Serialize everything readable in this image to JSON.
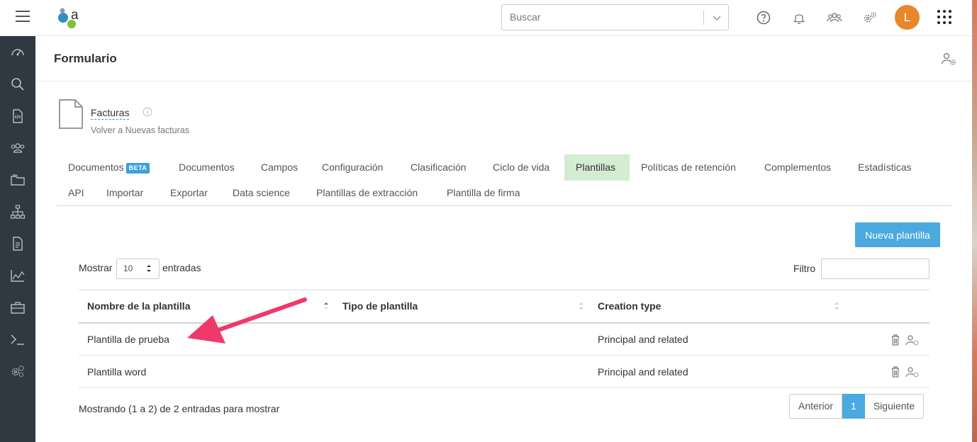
{
  "topbar": {
    "search_placeholder": "Buscar",
    "avatar_initial": "L",
    "icons": [
      "menu-icon",
      "help-icon",
      "bell-icon",
      "users-icon",
      "settings-icon",
      "apps-grid-icon"
    ]
  },
  "sidebar": {
    "icons": [
      "dashboard-icon",
      "search-icon",
      "code-file-icon",
      "group-icon",
      "folder-icon",
      "org-chart-icon",
      "document-icon",
      "chart-icon",
      "toolbox-icon",
      "terminal-icon",
      "gears-icon"
    ]
  },
  "page": {
    "title": "Formulario"
  },
  "form": {
    "name": "Facturas",
    "back_link": "Volver a Nuevas facturas"
  },
  "tabs": {
    "row1": [
      {
        "label": "Documentos",
        "badge": "BETA"
      },
      {
        "label": "Documentos"
      },
      {
        "label": "Campos"
      },
      {
        "label": "Configuración"
      },
      {
        "label": "Clasificación"
      },
      {
        "label": "Ciclo de vida"
      },
      {
        "label": "Plantillas",
        "active": true
      },
      {
        "label": "Políticas de retención"
      },
      {
        "label": "Complementos"
      },
      {
        "label": "Estadísticas"
      }
    ],
    "row2": [
      {
        "label": "API"
      },
      {
        "label": "Importar"
      },
      {
        "label": "Exportar"
      },
      {
        "label": "Data science"
      },
      {
        "label": "Plantillas de extracción"
      },
      {
        "label": "Plantilla de firma"
      }
    ]
  },
  "toolbar": {
    "new_button": "Nueva plantilla"
  },
  "list_controls": {
    "show_label": "Mostrar",
    "page_size": "10",
    "entries_label": "entradas",
    "filter_label": "Filtro"
  },
  "table": {
    "columns": [
      "Nombre de la plantilla",
      "Tipo de plantilla",
      "Creation type"
    ],
    "rows": [
      {
        "name": "Plantilla de prueba",
        "type": "",
        "creation": "Principal and related"
      },
      {
        "name": "Plantilla word",
        "type": "",
        "creation": "Principal and related"
      }
    ]
  },
  "footer": {
    "summary": "Mostrando (1 a 2) de 2 entradas para mostrar",
    "prev": "Anterior",
    "current_page": "1",
    "next": "Siguiente"
  },
  "colors": {
    "accent": "#4aa9de",
    "active_tab": "#d4ecd2",
    "avatar": "#e8862a",
    "sidebar": "#303841",
    "annotation_arrow": "#f0386b"
  }
}
